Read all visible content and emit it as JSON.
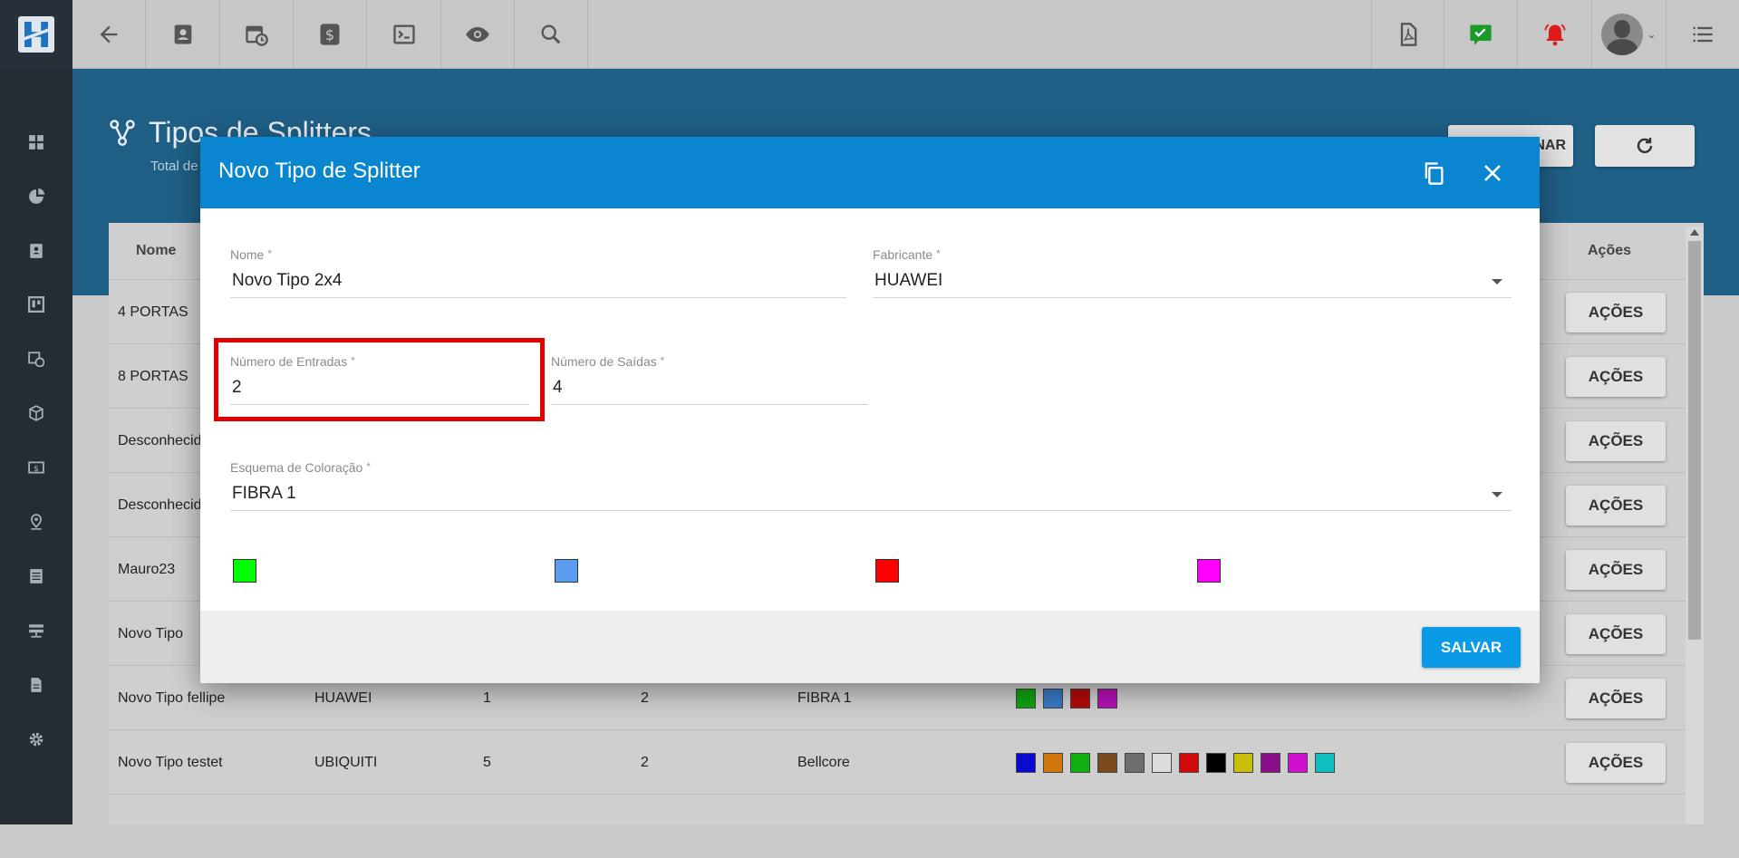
{
  "header": {
    "page_title": "Tipos de Splitters",
    "page_subtitle": "Total de",
    "add_button_label": "NAR"
  },
  "table": {
    "columns": [
      "Nome",
      "Ações"
    ],
    "rows": [
      {
        "name": "4 PORTAS",
        "action": "AÇÕES"
      },
      {
        "name": "8 PORTAS",
        "action": "AÇÕES"
      },
      {
        "name": "Desconhecid",
        "action": "AÇÕES"
      },
      {
        "name": "Desconhecid",
        "action": "AÇÕES"
      },
      {
        "name": "Mauro23",
        "action": "AÇÕES"
      },
      {
        "name": "Novo Tipo",
        "action": "AÇÕES"
      },
      {
        "name": "Novo Tipo fellipe",
        "manufacturer": "HUAWEI",
        "inputs": "1",
        "outputs": "2",
        "scheme": "FIBRA 1",
        "colors": [
          "#0fa30f",
          "#3a78c4",
          "#b30a0a",
          "#b410b4"
        ],
        "action": "AÇÕES"
      },
      {
        "name": "Novo Tipo testet",
        "manufacturer": "UBIQUITI",
        "inputs": "5",
        "outputs": "2",
        "scheme": "Bellcore",
        "colors": [
          "#0a0ad0",
          "#d0760a",
          "#10b010",
          "#7a4a1e",
          "#6e6e6e",
          "#dddddd",
          "#d00a0a",
          "#000000",
          "#c8c00a",
          "#8a108a",
          "#d010d0",
          "#10c0c0"
        ],
        "action": "AÇÕES"
      }
    ]
  },
  "modal": {
    "title": "Novo Tipo de Splitter",
    "fields": {
      "nome": {
        "label": "Nome",
        "value": "Novo Tipo 2x4"
      },
      "fabricante": {
        "label": "Fabricante",
        "value": "HUAWEI"
      },
      "entradas": {
        "label": "Número de Entradas",
        "value": "2"
      },
      "saidas": {
        "label": "Número de Saídas",
        "value": "4"
      },
      "esquema": {
        "label": "Esquema de Coloração",
        "value": "FIBRA 1"
      }
    },
    "required_mark": "*",
    "fiber_colors": [
      "#00ff00",
      "#5b9cf0",
      "#ff0000",
      "#ff00ff"
    ],
    "save_label": "SALVAR"
  }
}
